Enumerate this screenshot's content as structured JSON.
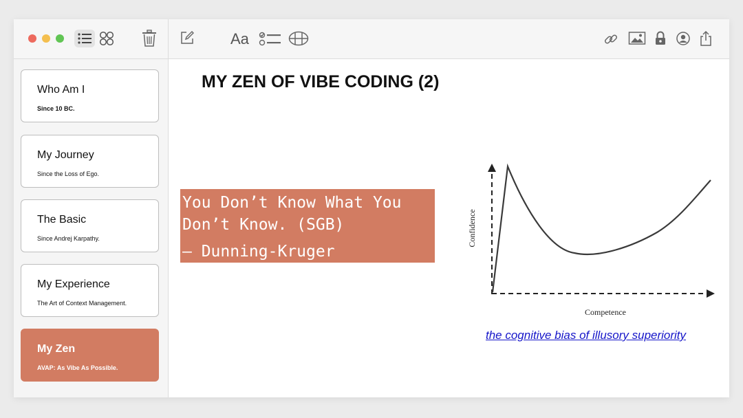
{
  "window": {
    "traffic_lights": {
      "close": "#ed6a5e",
      "minimize": "#f4bf4f",
      "zoom": "#61c554"
    }
  },
  "toolbar": {
    "sidebar_icons": [
      "list-view-icon",
      "gallery-view-icon",
      "trash-icon"
    ],
    "format_label": "Aa",
    "main_icons": [
      "compose-icon",
      "checklist-icon",
      "table-icon",
      "link-icon",
      "media-icon",
      "lock-icon",
      "collaborate-icon",
      "share-icon"
    ]
  },
  "sidebar": {
    "items": [
      {
        "title": "Who Am I",
        "subtitle": "Since 10 BC."
      },
      {
        "title": "My Journey",
        "subtitle": "Since the Loss of Ego."
      },
      {
        "title": "The Basic",
        "subtitle": "Since Andrej Karpathy."
      },
      {
        "title": "My Experience",
        "subtitle": "The Art of Context Management."
      },
      {
        "title": "My Zen",
        "subtitle": "AVAP: As Vibe As Possible.",
        "selected": true
      }
    ]
  },
  "main": {
    "title": "MY ZEN OF VIBE CODING (2)",
    "quote": {
      "line1": "You Don’t Know What You",
      "line2": "Don’t Know. (SGB)",
      "attribution": "– Dunning-Kruger"
    },
    "chart": {
      "ylabel": "Confidence",
      "xlabel": "Competence"
    },
    "link_text": "the cognitive bias of illusory superiority"
  },
  "colors": {
    "accent": "#d27c62",
    "link": "#1515c9",
    "sidebar_bg": "#f5f5f5",
    "toolbar_bg": "#f6f6f6"
  }
}
